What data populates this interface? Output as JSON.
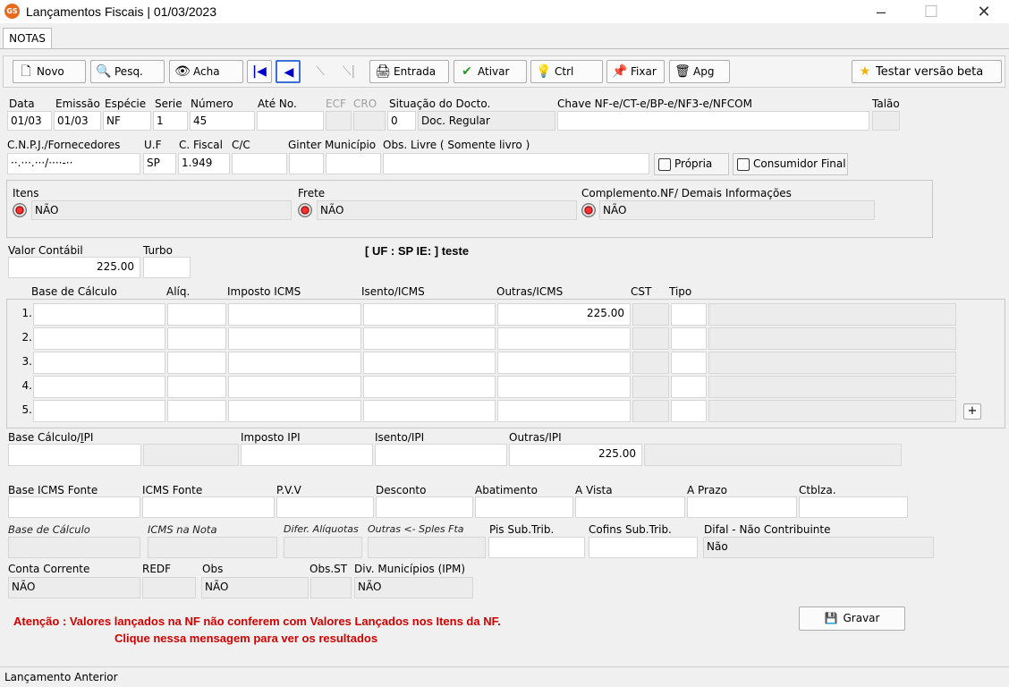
{
  "window": {
    "title": "Lançamentos Fiscais |  01/03/2023",
    "icon_text": "GS"
  },
  "tabs": [
    "NOTAS"
  ],
  "toolbar": {
    "novo": "Novo",
    "pesq": "Pesq.",
    "acha": "Acha",
    "entrada": "Entrada",
    "ativar": "Ativar",
    "ctrl": "Ctrl",
    "fixar": "Fixar",
    "apg": "Apg",
    "testar": "Testar versão beta"
  },
  "header": {
    "labels": {
      "data": "Data",
      "emissao": "Emissão",
      "especie": "Espécie",
      "serie": "Serie",
      "numero": "Número",
      "ate": "Até No.",
      "ecf": "ECF",
      "cro": "CRO",
      "situacao": "Situação do Docto.",
      "chave": "Chave NF-e/CT-e/BP-e/NF3-e/NFCOM",
      "talao": "Talão"
    },
    "values": {
      "data": "01/03",
      "emissao": "01/03",
      "especie": "NF",
      "serie": "1",
      "numero": "45",
      "ate": "",
      "situacao_code": "0",
      "situacao_text": "Doc. Regular",
      "chave": ""
    }
  },
  "row2": {
    "labels": {
      "cnpj": "C.N.P.J./Fornecedores",
      "uf": "U.F",
      "cfiscal": "C. Fiscal",
      "cc": "C/C",
      "ginter": "Ginter",
      "municipio": "Município",
      "obs": "Obs. Livre ( Somente livro )"
    },
    "values": {
      "cnpj": "··.···.···/····-··",
      "uf": "SP",
      "cfiscal": "1.949"
    },
    "propria": "Própria",
    "consumidor": "Consumidor Final"
  },
  "options": {
    "itens_label": "Itens",
    "itens_value": "NÃO",
    "frete_label": "Frete",
    "frete_value": "NÃO",
    "complemento_label": "Complemento.NF/ Demais Informações",
    "complemento_value": "NÃO"
  },
  "valor": {
    "contabil_label": "Valor Contábil",
    "contabil_value": "225.00",
    "turbo_label": "Turbo",
    "uf_info": "[ UF : SP IE:  ] teste"
  },
  "icms_grid": {
    "headers": {
      "base": "Base de Cálculo",
      "aliq": "Alíq.",
      "imposto": "Imposto ICMS",
      "isento": "Isento/ICMS",
      "outras": "Outras/ICMS",
      "cst": "CST",
      "tipo": "Tipo"
    },
    "rows": [
      {
        "n": "1.",
        "outras": "225.00"
      },
      {
        "n": "2.",
        "outras": ""
      },
      {
        "n": "3.",
        "outras": ""
      },
      {
        "n": "4.",
        "outras": ""
      },
      {
        "n": "5.",
        "outras": ""
      }
    ],
    "add": "+"
  },
  "ipi": {
    "base_label": "Base Cálculo/IPI",
    "imposto_label": "Imposto IPI",
    "isento_label": "Isento/IPI",
    "outras_label": "Outras/IPI",
    "outras_value": "225.00"
  },
  "fonte": {
    "base_label": "Base ICMS Fonte",
    "icms_label": "ICMS Fonte",
    "pvv_label": "P.V.V",
    "desconto_label": "Desconto",
    "abatimento_label": "Abatimento",
    "avista_label": "A Vista",
    "aprazo_label": "A Prazo",
    "ctblza_label": "Ctblza."
  },
  "st": {
    "base_label": "Base de Cálculo",
    "icms_nota_label": "ICMS na Nota",
    "difer_label": "Difer. Alíquotas",
    "outras_label": "Outras <- Sples Fta",
    "pis_label": "Pis Sub.Trib.",
    "cofins_label": "Cofins Sub.Trib.",
    "difal_label": "Difal - Não Contribuinte",
    "difal_value": "Não"
  },
  "bottom": {
    "conta_label": "Conta Corrente",
    "conta_value": "NÃO",
    "redf_label": "REDF",
    "obs_label": "Obs",
    "obs_value": "NÃO",
    "obsst_label": "Obs.ST",
    "div_label": "Div. Municípios (IPM)",
    "div_value": "NÃO"
  },
  "warning": {
    "line1": "Atenção : Valores lançados na NF não conferem com Valores Lançados nos Itens da NF.",
    "line2": "Clique nessa mensagem para ver os resultados"
  },
  "gravar": "Gravar",
  "status": "Lançamento Anterior",
  "colors": {
    "warning": "#d40000",
    "accent": "#0000cc"
  }
}
